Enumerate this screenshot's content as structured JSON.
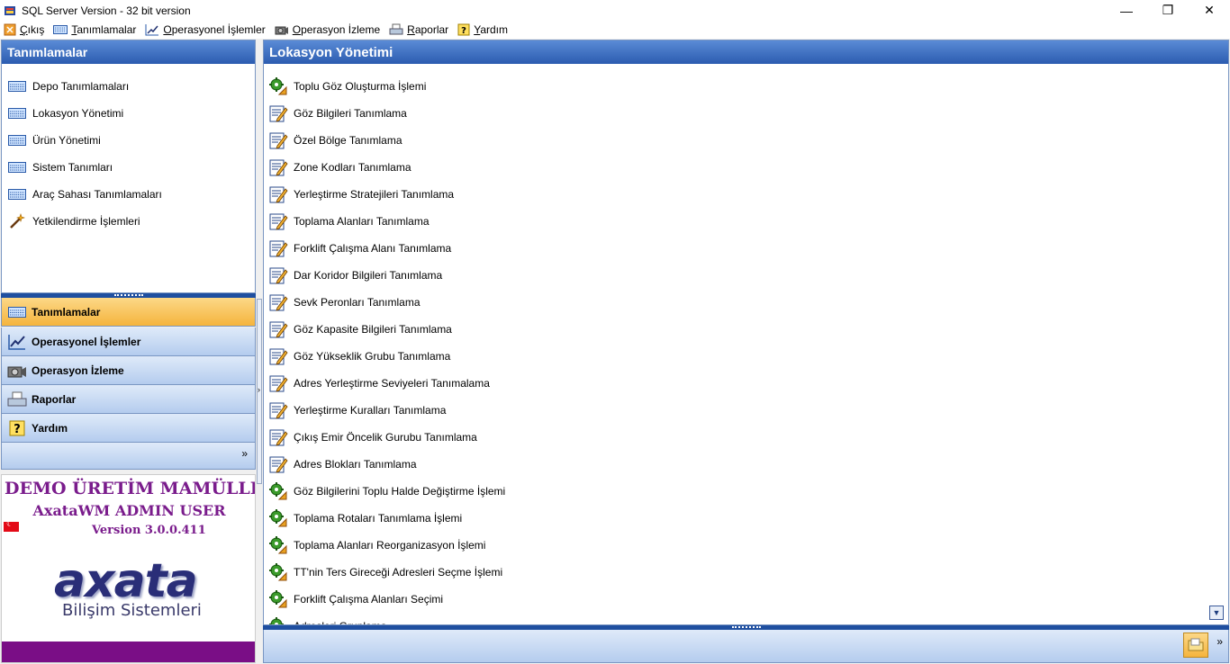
{
  "window": {
    "title": "SQL Server Version - 32 bit version",
    "minimize": "—",
    "maximize": "❐",
    "close": "✕"
  },
  "menubar": {
    "items": [
      {
        "label": "Çıkış",
        "icon": "exit-icon"
      },
      {
        "label": "Tanımlamalar",
        "icon": "keyboard-icon"
      },
      {
        "label": "Operasyonel İşlemler",
        "icon": "chart-pen-icon"
      },
      {
        "label": "Operasyon İzleme",
        "icon": "camera-icon"
      },
      {
        "label": "Raporlar",
        "icon": "printer-icon"
      },
      {
        "label": "Yardım",
        "icon": "help-icon"
      }
    ]
  },
  "left_panel": {
    "title": "Tanımlamalar",
    "items": [
      {
        "label": "Depo Tanımlamaları",
        "icon": "keyboard-icon"
      },
      {
        "label": "Lokasyon Yönetimi",
        "icon": "keyboard-icon"
      },
      {
        "label": "Ürün Yönetimi",
        "icon": "keyboard-icon"
      },
      {
        "label": "Sistem Tanımları",
        "icon": "keyboard-icon"
      },
      {
        "label": "Araç Sahası Tanımlamaları",
        "icon": "keyboard-icon"
      },
      {
        "label": "Yetkilendirme İşlemleri",
        "icon": "magic-wand-icon"
      }
    ]
  },
  "groups": [
    {
      "label": "Tanımlamalar",
      "icon": "keyboard-icon",
      "active": true
    },
    {
      "label": "Operasyonel İşlemler",
      "icon": "chart-pen-icon",
      "active": false
    },
    {
      "label": "Operasyon İzleme",
      "icon": "camera-icon",
      "active": false
    },
    {
      "label": "Raporlar",
      "icon": "printer-icon",
      "active": false
    },
    {
      "label": "Yardım",
      "icon": "help-icon",
      "active": false
    }
  ],
  "group_footer_chevron": "»",
  "logo": {
    "company": "DEMO ÜRETİM MAMÜLLERİ SAN.",
    "user": "AxataWM ADMIN USER",
    "version": "Version 3.0.0.411",
    "brand": "axata",
    "brand_sub": "Bilişim Sistemleri"
  },
  "splitter_arrow": "›",
  "right_panel": {
    "title": "Lokasyon Yönetimi",
    "tasks": [
      {
        "label": "Toplu Göz Oluşturma İşlemi",
        "icon": "gear-arrow-icon"
      },
      {
        "label": "Göz Bilgileri Tanımlama",
        "icon": "edit-form-icon"
      },
      {
        "label": "Özel Bölge Tanımlama",
        "icon": "edit-form-icon"
      },
      {
        "label": "Zone Kodları Tanımlama",
        "icon": "edit-form-icon"
      },
      {
        "label": "Yerleştirme Stratejileri Tanımlama",
        "icon": "edit-form-icon"
      },
      {
        "label": "Toplama Alanları Tanımlama",
        "icon": "edit-form-icon"
      },
      {
        "label": "Forklift Çalışma Alanı Tanımlama",
        "icon": "edit-form-icon"
      },
      {
        "label": "Dar Koridor Bilgileri Tanımlama",
        "icon": "edit-form-icon"
      },
      {
        "label": "Sevk Peronları Tanımlama",
        "icon": "edit-form-icon"
      },
      {
        "label": "Göz Kapasite Bilgileri Tanımlama",
        "icon": "edit-form-icon"
      },
      {
        "label": "Göz Yükseklik Grubu Tanımlama",
        "icon": "edit-form-icon"
      },
      {
        "label": "Adres Yerleştirme Seviyeleri Tanımalama",
        "icon": "edit-form-icon"
      },
      {
        "label": "Yerleştirme Kuralları Tanımlama",
        "icon": "edit-form-icon"
      },
      {
        "label": "Çıkış Emir Öncelik Gurubu Tanımlama",
        "icon": "edit-form-icon"
      },
      {
        "label": "Adres Blokları Tanımlama",
        "icon": "edit-form-icon"
      },
      {
        "label": "Göz Bilgilerini Toplu Halde Değiştirme İşlemi",
        "icon": "gear-arrow-icon"
      },
      {
        "label": "Toplama Rotaları Tanımlama İşlemi",
        "icon": "gear-arrow-icon"
      },
      {
        "label": "Toplama Alanları Reorganizasyon İşlemi",
        "icon": "gear-arrow-icon"
      },
      {
        "label": "TT'nin Ters Gireceği Adresleri Seçme İşlemi",
        "icon": "gear-arrow-icon"
      },
      {
        "label": "Forklift Çalışma Alanları Seçimi",
        "icon": "gear-arrow-icon"
      },
      {
        "label": "Adresleri Gruplama",
        "icon": "gear-arrow-icon"
      }
    ],
    "scroll_down": "▼"
  },
  "right_footer_chevron": "»",
  "colors": {
    "header_blue": "#2c5cb0",
    "active_orange": "#f5b43d",
    "brand_purple": "#7a1c8c"
  }
}
